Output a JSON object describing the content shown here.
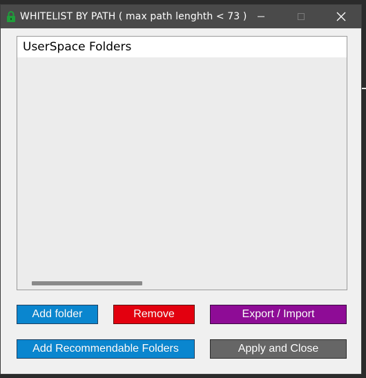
{
  "window": {
    "title": "WHITELIST BY PATH ( max path lenghth < 73 )",
    "icons": {
      "app": "lock-icon",
      "minimize": "minimize-icon",
      "maximize": "maximize-icon",
      "close": "close-icon"
    }
  },
  "list": {
    "header": "UserSpace Folders",
    "items": []
  },
  "buttons": {
    "add_folder": "Add folder",
    "remove": "Remove",
    "export_import": "Export / Import",
    "add_recommendable": "Add Recommendable Folders",
    "apply_close": "Apply and Close"
  },
  "colors": {
    "add_folder": "#0a86cf",
    "remove": "#e3000f",
    "export_import": "#8e0c96",
    "add_recommendable": "#0a86cf",
    "apply_close": "#666666",
    "title_bar": "#4a4a4a",
    "lock_icon": "#1f9e3a"
  }
}
